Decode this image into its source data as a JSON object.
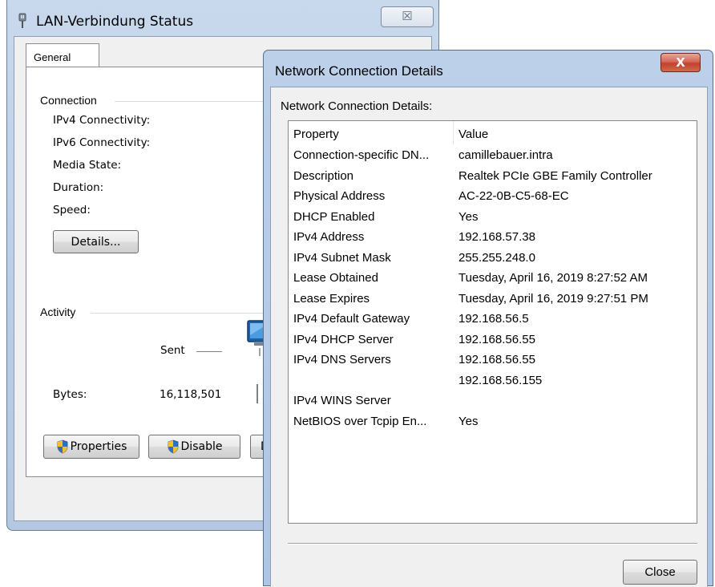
{
  "lan_window": {
    "title": "LAN-Verbindung Status",
    "close_glyph": "☒",
    "tab": "General",
    "connection_group": "Connection",
    "connection_fields": [
      "IPv4 Connectivity:",
      "IPv6 Connectivity:",
      "Media State:",
      "Duration:",
      "Speed:"
    ],
    "details_button": "Details...",
    "activity_group": "Activity",
    "sent_label": "Sent",
    "bytes_label": "Bytes:",
    "bytes_sent": "16,118,501",
    "properties_button": "Properties",
    "disable_button": "Disable",
    "diagnose_button_partial": "D"
  },
  "details_dialog": {
    "title": "Network Connection Details",
    "close_glyph": "X",
    "heading": "Network Connection Details:",
    "columns": [
      "Property",
      "Value"
    ],
    "rows": [
      {
        "property": "Connection-specific DN...",
        "value": "camillebauer.intra"
      },
      {
        "property": "Description",
        "value": "Realtek PCIe GBE Family Controller"
      },
      {
        "property": "Physical Address",
        "value": "AC-22-0B-C5-68-EC"
      },
      {
        "property": "DHCP Enabled",
        "value": "Yes"
      },
      {
        "property": "IPv4 Address",
        "value": "192.168.57.38"
      },
      {
        "property": "IPv4 Subnet Mask",
        "value": "255.255.248.0"
      },
      {
        "property": "Lease Obtained",
        "value": "Tuesday, April 16, 2019 8:27:52 AM"
      },
      {
        "property": "Lease Expires",
        "value": "Tuesday, April 16, 2019 9:27:51 PM"
      },
      {
        "property": "IPv4 Default Gateway",
        "value": "192.168.56.5"
      },
      {
        "property": "IPv4 DHCP Server",
        "value": "192.168.56.55"
      },
      {
        "property": "IPv4 DNS Servers",
        "value": "192.168.56.55"
      },
      {
        "property": "",
        "value": "192.168.56.155"
      },
      {
        "property": "IPv4 WINS Server",
        "value": ""
      },
      {
        "property": "NetBIOS over Tcpip En...",
        "value": "Yes"
      }
    ],
    "close_button": "Close"
  },
  "colors": {
    "window_frame": "#b9cde6",
    "close_red": "#c2412e",
    "panel": "#f0f0f0",
    "shield_blue": "#2f6fc4",
    "shield_yellow": "#f2c12e"
  }
}
